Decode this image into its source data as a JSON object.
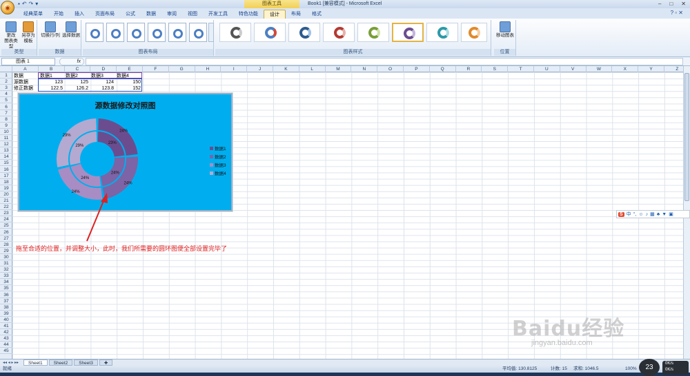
{
  "window": {
    "title": "Book1  [兼容模式] - Microsoft Excel",
    "context_tools": "图表工具"
  },
  "tabs": [
    "经典菜单",
    "开始",
    "插入",
    "页面布局",
    "公式",
    "数据",
    "审阅",
    "视图",
    "开发工具",
    "特色功能",
    "设计",
    "布局",
    "格式"
  ],
  "active_tab": "设计",
  "ribbon": {
    "type_group": {
      "label": "类型",
      "buttons": [
        "更改\n图表类型",
        "另存为\n模板"
      ]
    },
    "data_group": {
      "label": "数据",
      "buttons": [
        "切换行/列",
        "选择数据"
      ]
    },
    "layout_group": {
      "label": "图表布局"
    },
    "style_group": {
      "label": "图表样式"
    },
    "location_group": {
      "label": "位置",
      "buttons": [
        "移动图表"
      ]
    }
  },
  "formula_bar": {
    "name_box": "图表 1",
    "fx": "fx"
  },
  "columns": [
    "A",
    "B",
    "C",
    "D",
    "E",
    "F",
    "G",
    "H",
    "I",
    "J",
    "K",
    "L",
    "M",
    "N",
    "O",
    "P",
    "Q",
    "R",
    "S",
    "T",
    "U",
    "V",
    "W",
    "X",
    "Y",
    "Z"
  ],
  "rows": [
    "1",
    "2",
    "3",
    "4",
    "5",
    "6",
    "7",
    "8",
    "9",
    "10",
    "11",
    "12",
    "13",
    "14",
    "15",
    "16",
    "17",
    "18",
    "19",
    "20",
    "21",
    "22",
    "23",
    "24",
    "25",
    "26",
    "27",
    "28",
    "29",
    "30",
    "31",
    "32",
    "33",
    "34",
    "35",
    "36",
    "37",
    "38",
    "39",
    "40",
    "41",
    "42",
    "43",
    "44",
    "45"
  ],
  "cells": {
    "A1": "数据",
    "B1": "数据1",
    "C1": "数据2",
    "D1": "数据3",
    "E1": "数据4",
    "A2": "源数据",
    "B2": "123",
    "C2": "125",
    "D2": "124",
    "E2": "150",
    "A3": "修正数据",
    "B3": "122.5",
    "C3": "126.2",
    "D3": "123.8",
    "E3": "152"
  },
  "chart_data": {
    "type": "pie",
    "subtype": "doughnut",
    "title": "源数据修改对照图",
    "categories": [
      "数据1",
      "数据2",
      "数据3",
      "数据4"
    ],
    "series": [
      {
        "name": "源数据",
        "values": [
          123,
          125,
          124,
          150
        ]
      },
      {
        "name": "修正数据",
        "values": [
          122.5,
          126.2,
          123.8,
          152
        ]
      }
    ],
    "data_labels": {
      "outer": [
        "24%",
        "24%",
        "24%",
        "29%"
      ],
      "inner": [
        "23%",
        "24%",
        "24%",
        "29%"
      ]
    },
    "colors": [
      "#6b4d8f",
      "#7c64a6",
      "#a78dc4",
      "#b4a9d0"
    ],
    "background": "#00aeef",
    "legend_position": "right"
  },
  "annotation": "拖至合适的位置，并调整大小，此时，我们所需要的圆环图便全部设置完毕了",
  "sheets": [
    "Sheet1",
    "Sheet2",
    "Sheet3"
  ],
  "active_sheet": "Sheet1",
  "status": {
    "ready": "就绪",
    "average": "平均值: 130.8125",
    "count": "计数: 15",
    "sum": "求和: 1046.5",
    "zoom": "100%"
  },
  "ime_toolbar": {
    "logo": "S",
    "lang": "中"
  },
  "watermark": {
    "brand": "Baidu经验",
    "url": "jingyan.baidu.com"
  },
  "clock": {
    "big": "23",
    "small_top": "0K/s",
    "small_bottom": "0K/s"
  }
}
